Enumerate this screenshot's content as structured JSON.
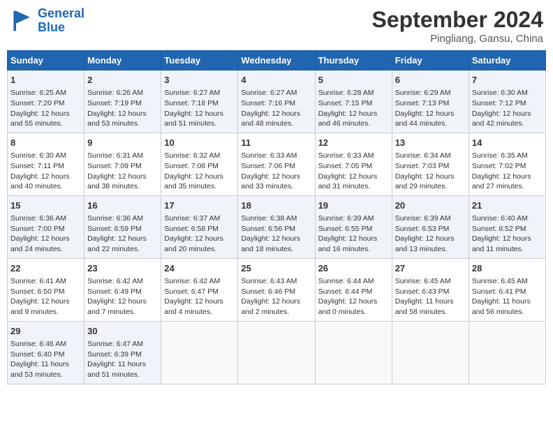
{
  "header": {
    "logo_line1": "General",
    "logo_line2": "Blue",
    "month": "September 2024",
    "location": "Pingliang, Gansu, China"
  },
  "days_of_week": [
    "Sunday",
    "Monday",
    "Tuesday",
    "Wednesday",
    "Thursday",
    "Friday",
    "Saturday"
  ],
  "weeks": [
    [
      {
        "day": 1,
        "text": "Sunrise: 6:25 AM\nSunset: 7:20 PM\nDaylight: 12 hours\nand 55 minutes."
      },
      {
        "day": 2,
        "text": "Sunrise: 6:26 AM\nSunset: 7:19 PM\nDaylight: 12 hours\nand 53 minutes."
      },
      {
        "day": 3,
        "text": "Sunrise: 6:27 AM\nSunset: 7:18 PM\nDaylight: 12 hours\nand 51 minutes."
      },
      {
        "day": 4,
        "text": "Sunrise: 6:27 AM\nSunset: 7:16 PM\nDaylight: 12 hours\nand 48 minutes."
      },
      {
        "day": 5,
        "text": "Sunrise: 6:28 AM\nSunset: 7:15 PM\nDaylight: 12 hours\nand 46 minutes."
      },
      {
        "day": 6,
        "text": "Sunrise: 6:29 AM\nSunset: 7:13 PM\nDaylight: 12 hours\nand 44 minutes."
      },
      {
        "day": 7,
        "text": "Sunrise: 6:30 AM\nSunset: 7:12 PM\nDaylight: 12 hours\nand 42 minutes."
      }
    ],
    [
      {
        "day": 8,
        "text": "Sunrise: 6:30 AM\nSunset: 7:11 PM\nDaylight: 12 hours\nand 40 minutes."
      },
      {
        "day": 9,
        "text": "Sunrise: 6:31 AM\nSunset: 7:09 PM\nDaylight: 12 hours\nand 38 minutes."
      },
      {
        "day": 10,
        "text": "Sunrise: 6:32 AM\nSunset: 7:08 PM\nDaylight: 12 hours\nand 35 minutes."
      },
      {
        "day": 11,
        "text": "Sunrise: 6:33 AM\nSunset: 7:06 PM\nDaylight: 12 hours\nand 33 minutes."
      },
      {
        "day": 12,
        "text": "Sunrise: 6:33 AM\nSunset: 7:05 PM\nDaylight: 12 hours\nand 31 minutes."
      },
      {
        "day": 13,
        "text": "Sunrise: 6:34 AM\nSunset: 7:03 PM\nDaylight: 12 hours\nand 29 minutes."
      },
      {
        "day": 14,
        "text": "Sunrise: 6:35 AM\nSunset: 7:02 PM\nDaylight: 12 hours\nand 27 minutes."
      }
    ],
    [
      {
        "day": 15,
        "text": "Sunrise: 6:36 AM\nSunset: 7:00 PM\nDaylight: 12 hours\nand 24 minutes."
      },
      {
        "day": 16,
        "text": "Sunrise: 6:36 AM\nSunset: 6:59 PM\nDaylight: 12 hours\nand 22 minutes."
      },
      {
        "day": 17,
        "text": "Sunrise: 6:37 AM\nSunset: 6:58 PM\nDaylight: 12 hours\nand 20 minutes."
      },
      {
        "day": 18,
        "text": "Sunrise: 6:38 AM\nSunset: 6:56 PM\nDaylight: 12 hours\nand 18 minutes."
      },
      {
        "day": 19,
        "text": "Sunrise: 6:39 AM\nSunset: 6:55 PM\nDaylight: 12 hours\nand 16 minutes."
      },
      {
        "day": 20,
        "text": "Sunrise: 6:39 AM\nSunset: 6:53 PM\nDaylight: 12 hours\nand 13 minutes."
      },
      {
        "day": 21,
        "text": "Sunrise: 6:40 AM\nSunset: 6:52 PM\nDaylight: 12 hours\nand 11 minutes."
      }
    ],
    [
      {
        "day": 22,
        "text": "Sunrise: 6:41 AM\nSunset: 6:50 PM\nDaylight: 12 hours\nand 9 minutes."
      },
      {
        "day": 23,
        "text": "Sunrise: 6:42 AM\nSunset: 6:49 PM\nDaylight: 12 hours\nand 7 minutes."
      },
      {
        "day": 24,
        "text": "Sunrise: 6:42 AM\nSunset: 6:47 PM\nDaylight: 12 hours\nand 4 minutes."
      },
      {
        "day": 25,
        "text": "Sunrise: 6:43 AM\nSunset: 6:46 PM\nDaylight: 12 hours\nand 2 minutes."
      },
      {
        "day": 26,
        "text": "Sunrise: 6:44 AM\nSunset: 6:44 PM\nDaylight: 12 hours\nand 0 minutes."
      },
      {
        "day": 27,
        "text": "Sunrise: 6:45 AM\nSunset: 6:43 PM\nDaylight: 11 hours\nand 58 minutes."
      },
      {
        "day": 28,
        "text": "Sunrise: 6:45 AM\nSunset: 6:41 PM\nDaylight: 11 hours\nand 56 minutes."
      }
    ],
    [
      {
        "day": 29,
        "text": "Sunrise: 6:46 AM\nSunset: 6:40 PM\nDaylight: 11 hours\nand 53 minutes."
      },
      {
        "day": 30,
        "text": "Sunrise: 6:47 AM\nSunset: 6:39 PM\nDaylight: 11 hours\nand 51 minutes."
      },
      null,
      null,
      null,
      null,
      null
    ]
  ]
}
